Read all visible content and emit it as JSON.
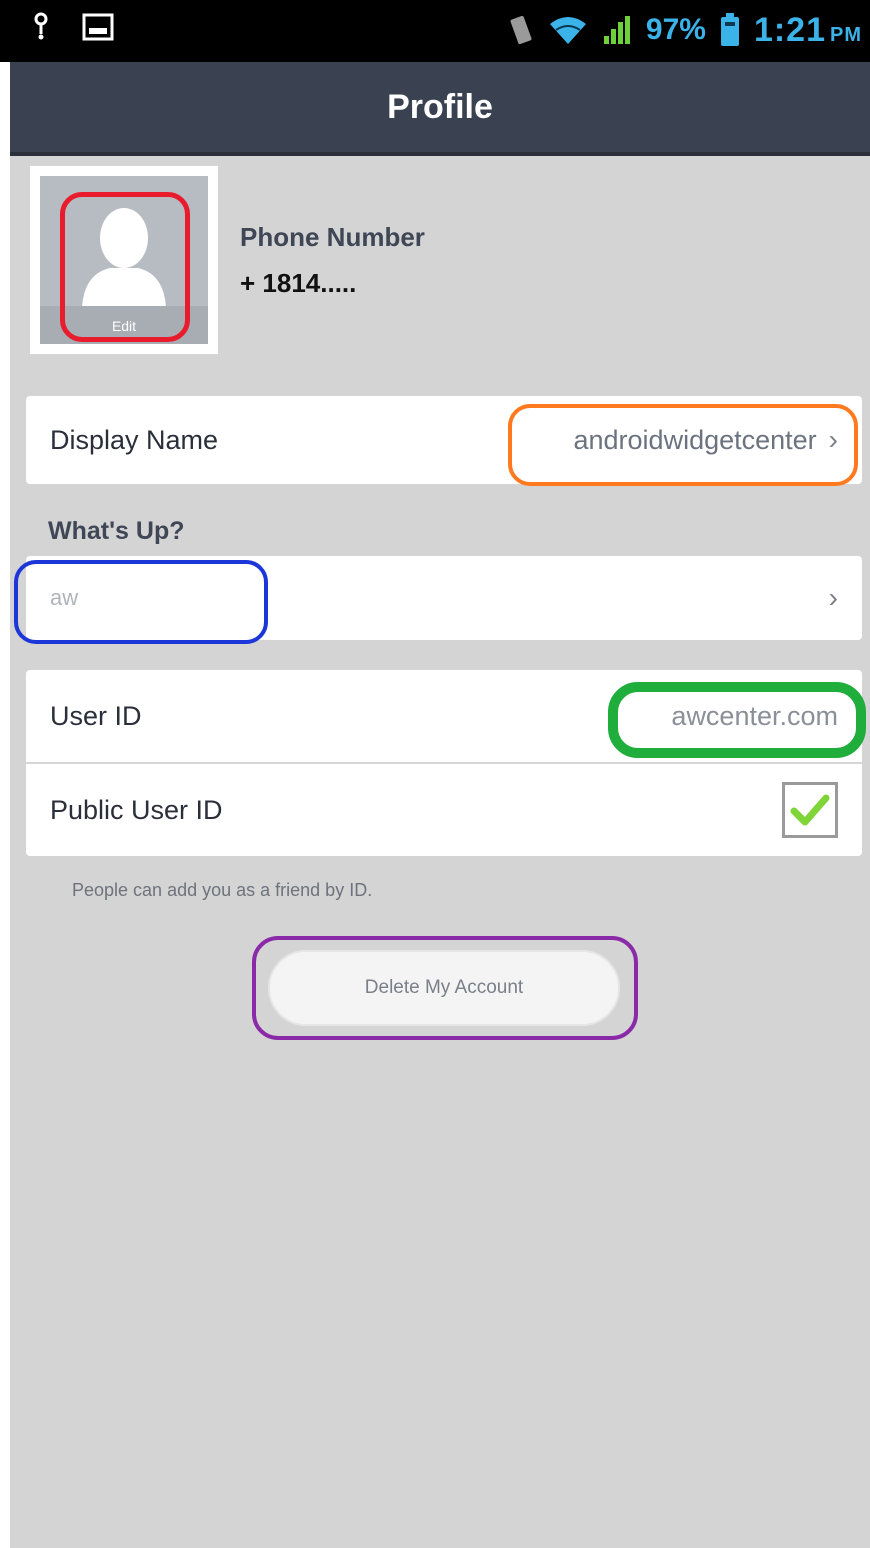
{
  "status_bar": {
    "battery_percent": "97%",
    "time": "1:21",
    "ampm": "PM"
  },
  "title_bar": {
    "title": "Profile"
  },
  "profile": {
    "avatar_edit_label": "Edit",
    "phone_label": "Phone Number",
    "phone_value": "+ 1814....."
  },
  "display_name": {
    "label": "Display Name",
    "value": "androidwidgetcenter"
  },
  "whats_up": {
    "section_label": "What's Up?",
    "value": "aw"
  },
  "user_id": {
    "label": "User ID",
    "value": "awcenter.com"
  },
  "public_user_id": {
    "label": "Public User ID",
    "checked": true
  },
  "hint": "People can add you as a friend by ID.",
  "delete_button": {
    "label": "Delete My Account"
  },
  "colors": {
    "title_bar_bg": "#3a4150",
    "checkmark": "#7fd437",
    "highlight_red": "#e81c2c",
    "highlight_orange": "#ff7a1f",
    "highlight_blue": "#1d36d8",
    "highlight_green": "#1fae3c",
    "highlight_purple": "#8a2aa8"
  },
  "icons": {
    "chevron": "chevron-right-icon",
    "checkmark": "checkmark-icon"
  }
}
